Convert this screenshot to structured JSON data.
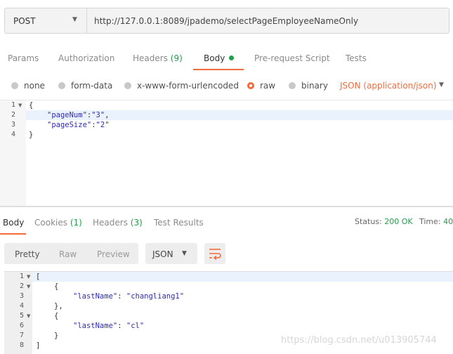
{
  "request": {
    "method": "POST",
    "url": "http://127.0.0.1:8089/jpademo/selectPageEmployeeNameOnly"
  },
  "request_tabs": [
    {
      "label": "Params"
    },
    {
      "label": "Authorization"
    },
    {
      "label": "Headers",
      "count": "(9)"
    },
    {
      "label": "Body"
    },
    {
      "label": "Pre-request Script"
    },
    {
      "label": "Tests"
    }
  ],
  "body_types": {
    "none": "none",
    "form_data": "form-data",
    "urlencoded": "x-www-form-urlencoded",
    "raw": "raw",
    "binary": "binary",
    "selected": "raw",
    "content_type": "JSON (application/json)"
  },
  "request_body": {
    "lines": [
      "1",
      "2",
      "3",
      "4"
    ],
    "open_brace": "{",
    "close_brace": "}",
    "k1": "\"pageNum\"",
    "v1": "\"3\"",
    "k2": "\"pageSize\"",
    "v2": "\"2\""
  },
  "response_tabs": [
    {
      "label": "Body"
    },
    {
      "label": "Cookies",
      "count": "(1)"
    },
    {
      "label": "Headers",
      "count": "(3)"
    },
    {
      "label": "Test Results"
    }
  ],
  "status": {
    "label": "Status:",
    "value": "200 OK",
    "time_label": "Time:",
    "time_value": "40"
  },
  "view_modes": [
    "Pretty",
    "Raw",
    "Preview"
  ],
  "format": "JSON",
  "response_body": {
    "lines": [
      "1",
      "2",
      "3",
      "4",
      "5",
      "6",
      "7",
      "8"
    ],
    "open_bracket": "[",
    "close_bracket": "]",
    "obj_open": "{",
    "obj_close": "},",
    "obj_close_last": "}",
    "key": "\"lastName\"",
    "v1": "\"changliang1\"",
    "v2": "\"cl\""
  },
  "watermark": "https://blog.csdn.net/u013905744",
  "colors": {
    "accent": "#f26b3a",
    "success": "#21a04b",
    "string": "#2f2bb0"
  }
}
